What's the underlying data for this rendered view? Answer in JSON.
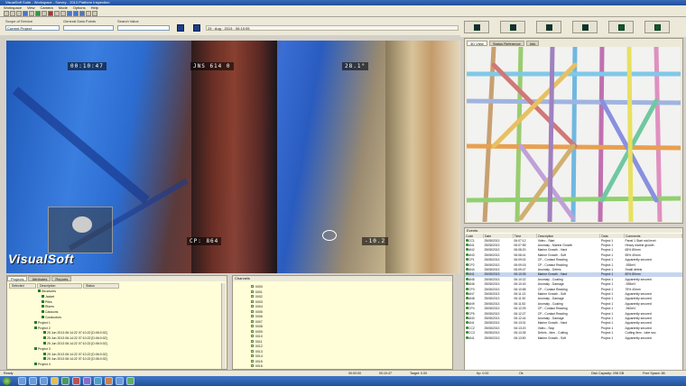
{
  "window": {
    "title": "VisualSoft Suite - Workspace - Survey - 2013 Platform Inspection"
  },
  "menu": [
    "Workspace",
    "View",
    "Camera",
    "Mode",
    "Options",
    "Help"
  ],
  "fields": {
    "scope_label": "Scope of Service",
    "scope_value": "General Data Points",
    "survey_label": "Search Value",
    "project_value": "Current Project",
    "date_value": "25 · Aug · 2013 · 06:10:05"
  },
  "video": {
    "ovl_time": "00:10:47",
    "ovl_kp": "JNS 614 0",
    "ovl_heading": "28.1°",
    "ovl_cp": "CP: 864",
    "ovl_depth": "-10.2",
    "logo_text": "VisualSoft"
  },
  "model_tabs": [
    "3D View",
    "Status Reference",
    "Info"
  ],
  "events": {
    "header": "Events",
    "columns": [
      "Code",
      "Date",
      "Time",
      "Description",
      "Data",
      "Comments"
    ],
    "rows": [
      [
        "CC1",
        "25/08/2013",
        "06:07:12",
        "Video - Start",
        "Project 1",
        "Panel 1 Start mid level"
      ],
      [
        "AN1",
        "25/08/2013",
        "06:07:55",
        "Anomaly - Marine Growth",
        "Project 1",
        "Heavy marine growth"
      ],
      [
        "AN2",
        "25/08/2013",
        "06:08:20",
        "Marine Growth - Hard",
        "Project 1",
        "65% 80mm"
      ],
      [
        "AN3",
        "25/08/2013",
        "06:08:41",
        "Marine Growth - Soft",
        "Project 1",
        "55% 40mm"
      ],
      [
        "CP1",
        "25/08/2013",
        "06:09:02",
        "CP - Contact Reading",
        "Project 1",
        "Apparently secured"
      ],
      [
        "CP2",
        "25/08/2013",
        "06:09:18",
        "CP - Contact Reading",
        "Project 1",
        "-935mV"
      ],
      [
        "AN4",
        "25/08/2013",
        "06:09:47",
        "Anomaly - Debris",
        "Project 1",
        "Small debris"
      ],
      [
        "AN1",
        "25/08/2013",
        "06:10:05",
        "Marine Growth - Hard",
        "Project 1",
        "80% 80mm"
      ],
      [
        "AN5",
        "25/08/2013",
        "06:10:22",
        "Anomaly - Coating",
        "Project 1",
        "Apparently secured"
      ],
      [
        "AN6",
        "25/08/2013",
        "06:10:40",
        "Anomaly - Damage",
        "Project 1",
        "-935mV"
      ],
      [
        "CP3",
        "25/08/2013",
        "06:10:58",
        "CP - Contact Reading",
        "Project 1",
        "75% 40mm"
      ],
      [
        "AN7",
        "25/08/2013",
        "06:11:13",
        "Marine Growth - Soft",
        "Project 1",
        "Apparently secured"
      ],
      [
        "AN8",
        "25/08/2013",
        "06:11:30",
        "Anomaly - Damage",
        "Project 1",
        "Apparently secured"
      ],
      [
        "AN9",
        "25/08/2013",
        "06:11:52",
        "Anomaly - Coating",
        "Project 1",
        "Apparently secured"
      ],
      [
        "CP4",
        "25/08/2013",
        "06:12:09",
        "CP - Contact Reading",
        "Project 1",
        "-940mV"
      ],
      [
        "CP5",
        "25/08/2013",
        "06:12:27",
        "CP - Contact Reading",
        "Project 1",
        "Apparently secured"
      ],
      [
        "AN0",
        "25/08/2013",
        "06:12:44",
        "Anomaly - Damage",
        "Project 1",
        "Apparently secured"
      ],
      [
        "AN1",
        "25/08/2013",
        "06:13:01",
        "Marine Growth - Hard",
        "Project 1",
        "Apparently secured"
      ],
      [
        "CC2",
        "25/08/2013",
        "06:13:20",
        "Video - Stop",
        "Project 1",
        "Apparently secured"
      ],
      [
        "CC3",
        "25/08/2013",
        "06:13:35",
        "Debris - Item - Cutting",
        "Project 1",
        "Cutting item - tube sec."
      ],
      [
        "AN1",
        "25/08/2013",
        "06:13:50",
        "Marine Growth - Soft",
        "Project 1",
        "Apparently secured"
      ]
    ]
  },
  "projects": {
    "tabs": [
      "Projects",
      "Attributes",
      "Reports"
    ],
    "columns": [
      "Selected",
      "Description",
      "Status"
    ],
    "tree": [
      "Structures",
      "Jacket",
      "Piles",
      "Risers",
      "Caissons",
      "Conductors",
      "Project 1",
      "Project 2",
      "25 Jun 2013 06:14:22 07:10:22 [D:06:0:02]",
      "25 Jun 2013 06:14:22 07:10:22 [D:06:0:02]",
      "25 Jun 2013 06:14:22 07:10:22 [D:06:0:02]",
      "Project 3",
      "25 Jun 2013 06:14:22 07:10:22 [D:06:0:02]",
      "25 Jun 2013 06:14:22 07:10:22 [D:06:0:02]",
      "Project 4"
    ]
  },
  "layers": {
    "header": "Channels",
    "rows": [
      "0000",
      "0001",
      "0002",
      "0003",
      "0004",
      "0005",
      "0006",
      "0007",
      "0008",
      "0009",
      "0010",
      "0011",
      "0012",
      "0013",
      "0014",
      "0015",
      "0016"
    ]
  },
  "status": {
    "left": "Ready",
    "s1": "00:00:00",
    "s2": "00:10:47",
    "s3": "Target: 0.00",
    "s4": "Kp: 0.00",
    "s5": "Ok",
    "s6": "Disk Capacity: 298 GB",
    "s7": "Free Space: 86"
  },
  "colors": {
    "accent": "#1f4f9a",
    "chrome": "#ece9d8",
    "panel_bg": "#fffed8"
  }
}
